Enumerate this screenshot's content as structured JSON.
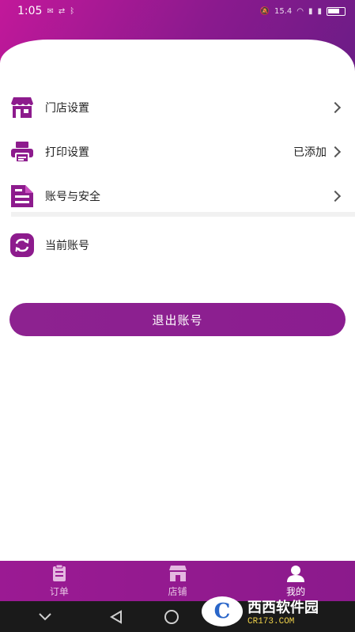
{
  "status_bar": {
    "time": "1:05",
    "left_icons": [
      "message-icon",
      "sync-icon",
      "bluetooth-icon"
    ],
    "right_icons": [
      "mute-icon",
      "speed-readout",
      "wifi-icon",
      "signal-icon",
      "signal-icon"
    ],
    "network_speed": "15.4"
  },
  "menu": {
    "items": [
      {
        "label": "门店设置",
        "value": "",
        "icon": "store-icon"
      },
      {
        "label": "打印设置",
        "value": "已添加",
        "icon": "printer-icon"
      },
      {
        "label": "账号与安全",
        "value": "",
        "icon": "document-icon"
      }
    ],
    "current_account": {
      "label": "当前账号",
      "icon": "switch-account-icon"
    }
  },
  "logout_button": "退出账号",
  "tabbar": {
    "tabs": [
      {
        "label": "订单",
        "icon": "order-icon",
        "active": false
      },
      {
        "label": "店铺",
        "icon": "shop-icon",
        "active": false
      },
      {
        "label": "我的",
        "icon": "user-icon",
        "active": true
      }
    ]
  },
  "watermark": {
    "title": "西西软件园",
    "sub": "CR173.COM"
  },
  "colors": {
    "primary": "#8b1d90",
    "accent": "#c2189a",
    "icon": "#8d1b8d"
  }
}
